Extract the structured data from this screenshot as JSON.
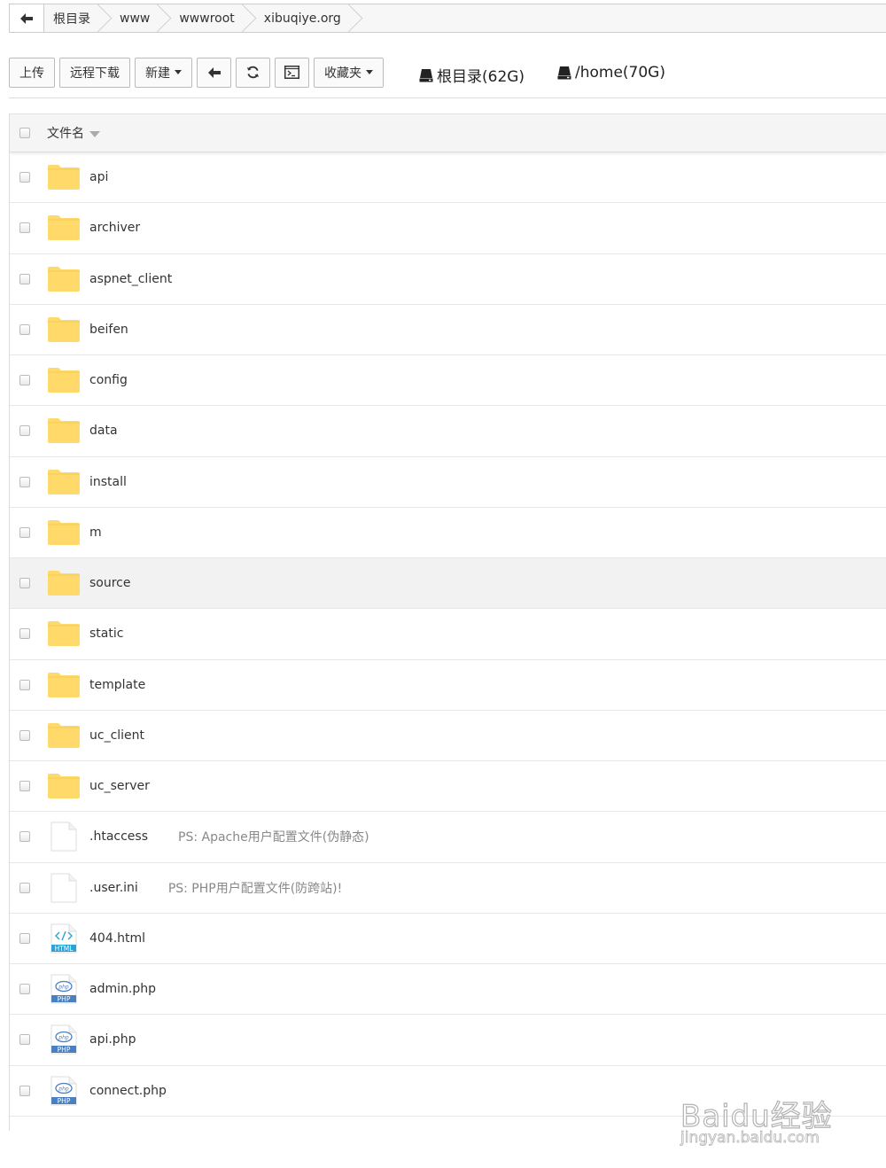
{
  "breadcrumb": {
    "items": [
      {
        "label": "根目录"
      },
      {
        "label": "www"
      },
      {
        "label": "wwwroot"
      },
      {
        "label": "xibuqiye.org"
      }
    ]
  },
  "toolbar": {
    "upload_label": "上传",
    "remote_download_label": "远程下载",
    "new_label": "新建",
    "favorites_label": "收藏夹",
    "icons": [
      "back-icon",
      "refresh-icon",
      "terminal-icon"
    ]
  },
  "disks": [
    {
      "label": "根目录(62G)"
    },
    {
      "label": "/home(70G)"
    }
  ],
  "table": {
    "header": {
      "name_label": "文件名"
    },
    "rows": [
      {
        "name": "api",
        "type": "folder",
        "note": ""
      },
      {
        "name": "archiver",
        "type": "folder",
        "note": ""
      },
      {
        "name": "aspnet_client",
        "type": "folder",
        "note": ""
      },
      {
        "name": "beifen",
        "type": "folder",
        "note": ""
      },
      {
        "name": "config",
        "type": "folder",
        "note": ""
      },
      {
        "name": "data",
        "type": "folder",
        "note": ""
      },
      {
        "name": "install",
        "type": "folder",
        "note": ""
      },
      {
        "name": "m",
        "type": "folder",
        "note": ""
      },
      {
        "name": "source",
        "type": "folder",
        "note": ""
      },
      {
        "name": "static",
        "type": "folder",
        "note": ""
      },
      {
        "name": "template",
        "type": "folder",
        "note": ""
      },
      {
        "name": "uc_client",
        "type": "folder",
        "note": ""
      },
      {
        "name": "uc_server",
        "type": "folder",
        "note": ""
      },
      {
        "name": ".htaccess",
        "type": "file",
        "note": "PS: Apache用户配置文件(伪静态)"
      },
      {
        "name": ".user.ini",
        "type": "file",
        "note": "PS: PHP用户配置文件(防跨站)!"
      },
      {
        "name": "404.html",
        "type": "html",
        "note": ""
      },
      {
        "name": "admin.php",
        "type": "php",
        "note": ""
      },
      {
        "name": "api.php",
        "type": "php",
        "note": ""
      },
      {
        "name": "connect.php",
        "type": "php",
        "note": ""
      }
    ]
  },
  "file_badges": {
    "html": "HTML",
    "php": "PHP"
  },
  "colors": {
    "folder": "#ffd96a",
    "php_badge": "#4a7fc1",
    "html_badge": "#2aa3d6"
  },
  "watermark": {
    "main": "Baidu经验",
    "sub": "jingyan.baidu.com"
  }
}
